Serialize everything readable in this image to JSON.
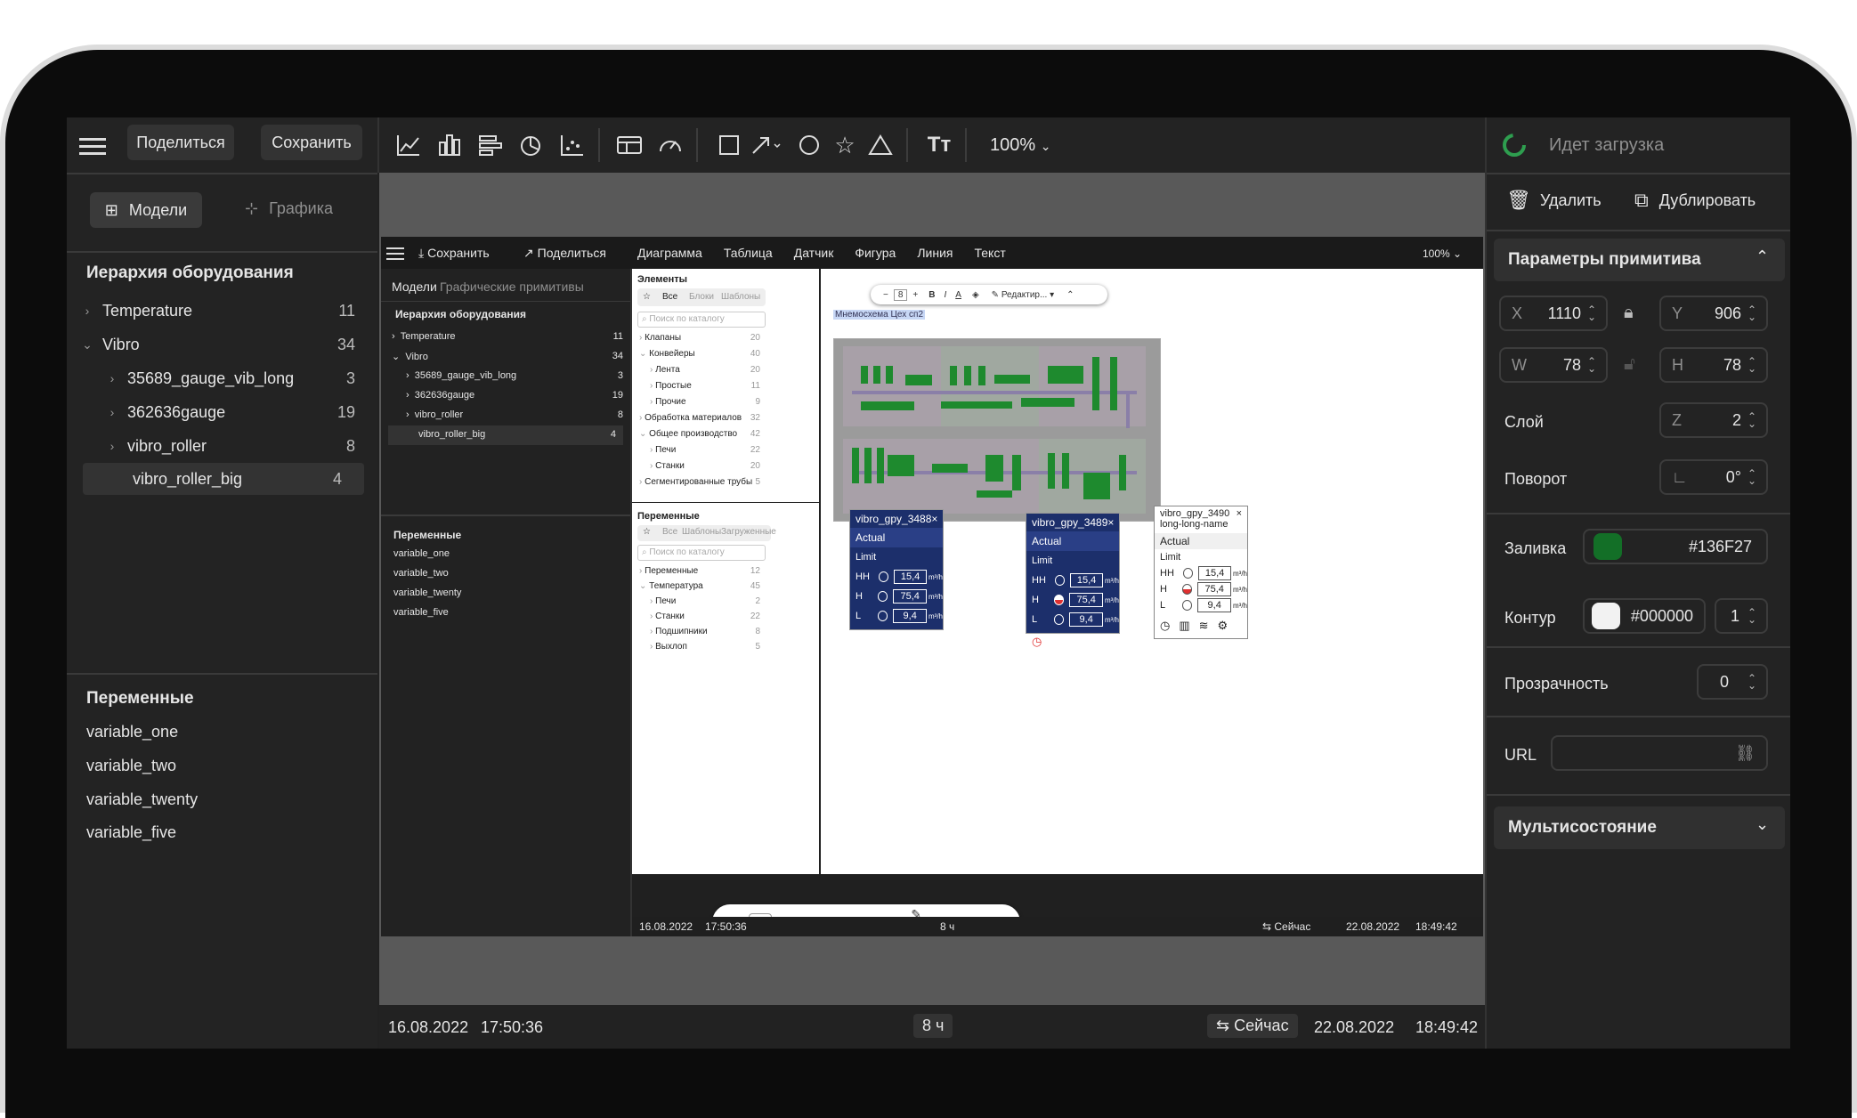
{
  "left_panel": {
    "share_label": "Поделиться",
    "save_label": "Сохранить",
    "tab_models": "Модели",
    "tab_graphics": "Графика",
    "hierarchy_title": "Иерархия оборудования",
    "items": [
      {
        "label": "Temperature",
        "count": "11"
      },
      {
        "label": "Vibro",
        "count": "34"
      },
      {
        "label": "35689_gauge_vib_long",
        "count": "3"
      },
      {
        "label": "362636gauge",
        "count": "19"
      },
      {
        "label": "vibro_roller",
        "count": "8"
      },
      {
        "label": "vibro_roller_big",
        "count": "4"
      }
    ],
    "variables_title": "Переменные",
    "variables": [
      "variable_one",
      "variable_two",
      "variable_twenty",
      "variable_five"
    ]
  },
  "toolbar": {
    "zoom": "100%"
  },
  "right_panel": {
    "loading": "Идет загрузка",
    "delete_label": "Удалить",
    "duplicate_label": "Дублировать",
    "params_title": "Параметры примитива",
    "x_label": "X",
    "x_value": "1110",
    "y_label": "Y",
    "y_value": "906",
    "w_label": "W",
    "w_value": "78",
    "h_label": "H",
    "h_value": "78",
    "layer_label": "Слой",
    "z_label": "Z",
    "z_value": "2",
    "rotation_label": "Поворот",
    "rotation_value": "0°",
    "fill_label": "Заливка",
    "fill_value": "#136F27",
    "fill_color": "#136F27",
    "stroke_label": "Контур",
    "stroke_value": "#000000",
    "stroke_width": "1",
    "opacity_label": "Прозрачность",
    "opacity_value": "0",
    "url_label": "URL",
    "multistate_label": "Мультисостояние"
  },
  "status": {
    "start_date": "16.08.2022",
    "start_time": "17:50:36",
    "range": "8 ч",
    "now": "Сейчас",
    "end_date": "22.08.2022",
    "end_time": "18:49:42"
  },
  "inner": {
    "save": "Сохранить",
    "share": "Поделиться",
    "menu": [
      "Диаграмма",
      "Таблица",
      "Датчик",
      "Фигура",
      "Линия",
      "Текст"
    ],
    "zoom": "100%",
    "tab_models": "Модели",
    "tab_primitives": "Графические примитивы",
    "hierarchy_title": "Иерархия оборудования",
    "items": [
      {
        "label": "Temperature",
        "count": "11"
      },
      {
        "label": "Vibro",
        "count": "34"
      },
      {
        "label": "35689_gauge_vib_long",
        "count": "3"
      },
      {
        "label": "362636gauge",
        "count": "19"
      },
      {
        "label": "vibro_roller",
        "count": "8"
      },
      {
        "label": "vibro_roller_big",
        "count": "4"
      }
    ],
    "variables_title": "Переменные",
    "variables": [
      "variable_one",
      "variable_two",
      "variable_twenty",
      "variable_five"
    ],
    "elements_title": "Элементы",
    "el_tabs": [
      "Все",
      "Блоки",
      "Шаблоны"
    ],
    "search_placeholder": "Поиск по каталогу",
    "catalog": [
      {
        "label": "Клапаны",
        "count": "20"
      },
      {
        "label": "Конвейеры",
        "count": "40"
      },
      {
        "label": "Лента",
        "count": "20"
      },
      {
        "label": "Простые",
        "count": "11"
      },
      {
        "label": "Прочие",
        "count": "9"
      },
      {
        "label": "Обработка материалов",
        "count": "32"
      },
      {
        "label": "Общее производство",
        "count": "42"
      },
      {
        "label": "Печи",
        "count": "22"
      },
      {
        "label": "Станки",
        "count": "20"
      },
      {
        "label": "Сегментированные трубы",
        "count": "5"
      }
    ],
    "vars_title": "Переменные",
    "var_tabs": [
      "Все",
      "Шаблоны",
      "Загруженные"
    ],
    "var_catalog": [
      {
        "label": "Переменные",
        "count": "12"
      },
      {
        "label": "Температура",
        "count": "45"
      },
      {
        "label": "Печи",
        "count": "2"
      },
      {
        "label": "Станки",
        "count": "22"
      },
      {
        "label": "Подшипники",
        "count": "8"
      },
      {
        "label": "Выхлоп",
        "count": "5"
      }
    ],
    "scheme_label": "Мнемосхема Цех сп2",
    "font_size": "8",
    "edit_label": "Редактир...",
    "popups": [
      {
        "title": "vibro_gpy_3488",
        "actual": "Actual",
        "limit": "Limit",
        "hh": "15,4",
        "h": "75,4",
        "l": "9,4",
        "unit": "m³/h"
      },
      {
        "title": "vibro_gpy_3489",
        "actual": "Actual",
        "limit": "Limit",
        "hh": "15,4",
        "h": "75,4",
        "l": "9,4",
        "unit": "m³/h"
      },
      {
        "title": "vibro_gpy_3490 long-long-name",
        "actual": "Actual",
        "limit": "Limit",
        "hh": "15,4",
        "h": "75,4",
        "l": "9,4",
        "unit": "m³/h"
      }
    ],
    "status": {
      "start": "16.08.2022",
      "time": "17:50:36",
      "range": "8 ч",
      "now": "Сейчас",
      "end": "22.08.2022",
      "end_time": "18:49:42"
    }
  },
  "labels": {
    "hh": "HH",
    "h": "H",
    "l": "L"
  },
  "colors": {
    "accent": "#2e9e4f",
    "fill": "#136F27"
  }
}
